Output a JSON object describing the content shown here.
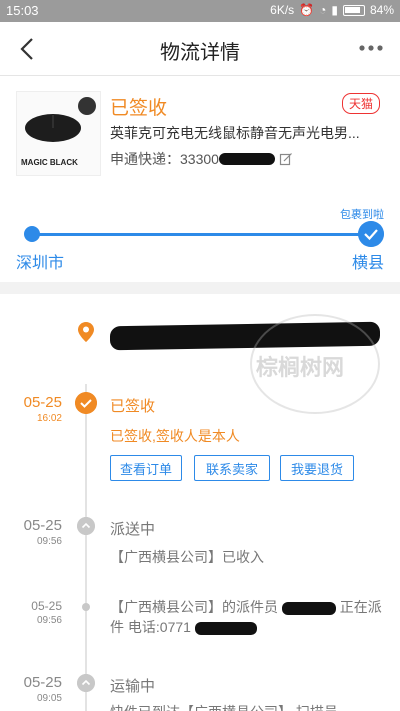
{
  "statusbar": {
    "time": "15:03",
    "speed": "6K/s",
    "battery": "84%"
  },
  "nav": {
    "title": "物流详情"
  },
  "product": {
    "status": "已签收",
    "store_badge": "天猫",
    "name": "英菲克可充电无线鼠标静音无声光电男...",
    "courier_label": "申通快递：",
    "tracking_prefix": "33300",
    "brand_text": "MAGIC BLACK"
  },
  "route": {
    "arrived_label": "包裹到啦",
    "from": "深圳市",
    "to": "横县"
  },
  "watermark": {
    "text": "棕榈树网"
  },
  "events": [
    {
      "date": "05-25",
      "time": "16:02",
      "status": "已签收",
      "desc": "已签收,签收人是本人"
    },
    {
      "date": "05-25",
      "time": "09:56",
      "status": "派送中",
      "desc": "【广西横县公司】已收入"
    },
    {
      "date": "05-25",
      "time": "09:56",
      "desc_a": "【广西横县公司】的派件员",
      "desc_b": "正在派件 电话:0771"
    },
    {
      "date": "05-25",
      "time": "09:05",
      "status": "运输中",
      "desc": "快件已到达【广西横县公司】 扫描员"
    }
  ],
  "actions": {
    "view_order": "查看订单",
    "contact_seller": "联系卖家",
    "return": "我要退货"
  },
  "colors": {
    "accent_orange": "#f08a24",
    "accent_blue": "#2d8ae8",
    "tmall_red": "#e33333"
  }
}
